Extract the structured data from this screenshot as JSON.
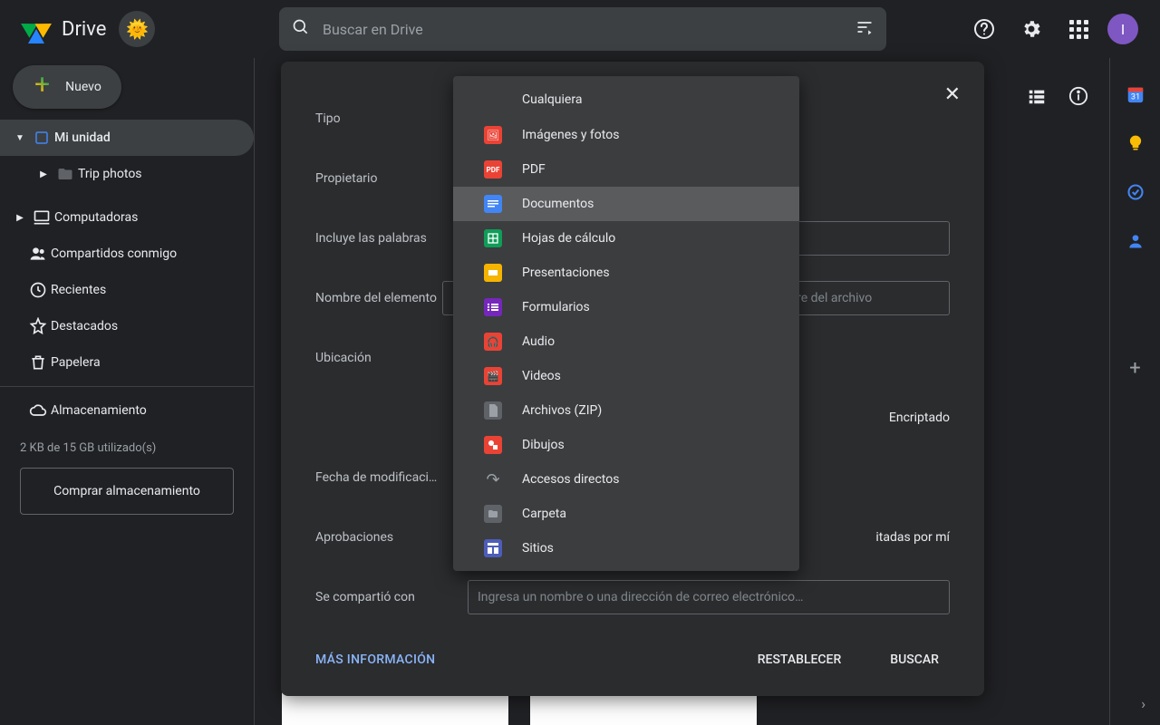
{
  "header": {
    "app_name": "Drive",
    "search_placeholder": "Buscar en Drive",
    "avatar_letter": "I"
  },
  "sidebar": {
    "new_label": "Nuevo",
    "items": [
      {
        "label": "Mi unidad",
        "icon": "drive"
      },
      {
        "label": "Trip photos",
        "icon": "folder"
      },
      {
        "label": "Computadoras",
        "icon": "computer"
      },
      {
        "label": "Compartidos conmigo",
        "icon": "shared"
      },
      {
        "label": "Recientes",
        "icon": "clock"
      },
      {
        "label": "Destacados",
        "icon": "star"
      },
      {
        "label": "Papelera",
        "icon": "trash"
      },
      {
        "label": "Almacenamiento",
        "icon": "cloud"
      }
    ],
    "storage_text": "2 KB de 15 GB utilizado(s)",
    "buy_storage": "Comprar almacenamiento"
  },
  "panel": {
    "labels": {
      "type": "Tipo",
      "owner": "Propietario",
      "has_words": "Incluye las palabras",
      "item_name": "Nombre del elemento",
      "location": "Ubicación",
      "encrypted": "Encriptado",
      "date_modified": "Fecha de modificaci…",
      "approvals": "Aprobaciones",
      "approvals_tail": "itadas por mí",
      "shared_with": "Se compartió con"
    },
    "placeholders": {
      "item_name": "mbre del archivo",
      "shared_with": "Ingresa un nombre o una dirección de correo electrónico…"
    },
    "footer": {
      "more_info": "MÁS INFORMACIÓN",
      "reset": "RESTABLECER",
      "search": "BUSCAR"
    }
  },
  "type_menu": [
    {
      "label": "Cualquiera",
      "icon": ""
    },
    {
      "label": "Imágenes y fotos",
      "icon": "img"
    },
    {
      "label": "PDF",
      "icon": "pdf"
    },
    {
      "label": "Documentos",
      "icon": "doc"
    },
    {
      "label": "Hojas de cálculo",
      "icon": "sheet"
    },
    {
      "label": "Presentaciones",
      "icon": "slide"
    },
    {
      "label": "Formularios",
      "icon": "form"
    },
    {
      "label": "Audio",
      "icon": "audio"
    },
    {
      "label": "Videos",
      "icon": "video"
    },
    {
      "label": "Archivos (ZIP)",
      "icon": "zip"
    },
    {
      "label": "Dibujos",
      "icon": "draw"
    },
    {
      "label": "Accesos directos",
      "icon": "short"
    },
    {
      "label": "Carpeta",
      "icon": "folder"
    },
    {
      "label": "Sitios",
      "icon": "site"
    }
  ]
}
